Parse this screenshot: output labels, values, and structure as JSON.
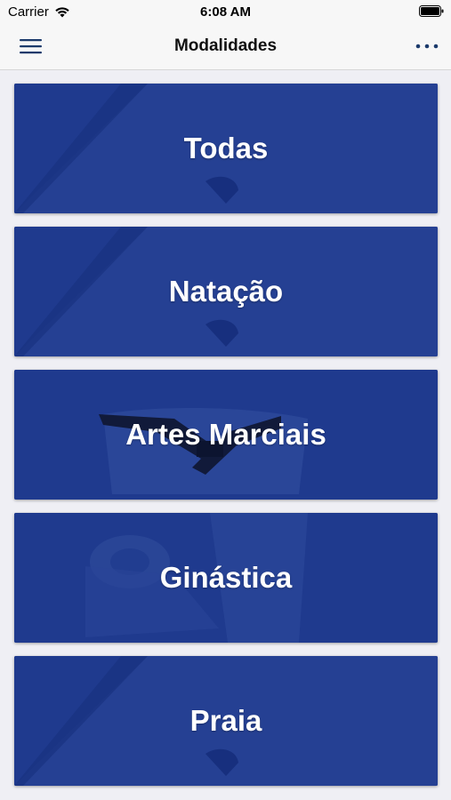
{
  "status_bar": {
    "carrier": "Carrier",
    "time": "6:08 AM",
    "wifi_icon": "wifi-icon",
    "battery_icon": "battery-icon"
  },
  "nav_bar": {
    "title": "Modalidades",
    "menu_icon": "hamburger-menu-icon",
    "more_icon": "more-dots-icon",
    "accent_color": "#1b3a6b"
  },
  "categories": [
    {
      "label": "Todas"
    },
    {
      "label": "Natação"
    },
    {
      "label": "Artes Marciais"
    },
    {
      "label": "Ginástica"
    },
    {
      "label": "Praia"
    }
  ],
  "colors": {
    "card_overlay": "#1f3a8e",
    "background": "#efeff4",
    "label_text": "#ffffff"
  }
}
